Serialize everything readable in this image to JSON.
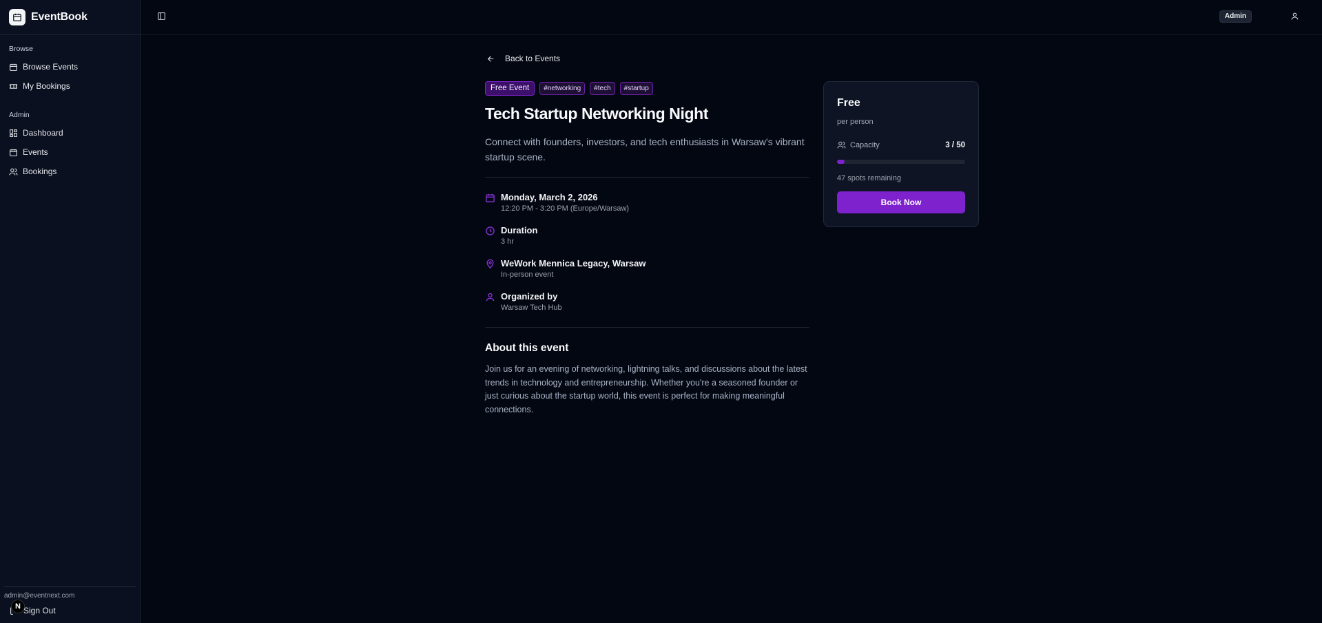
{
  "app": {
    "name": "EventBook"
  },
  "sidebar": {
    "groups": [
      {
        "label": "Browse",
        "items": [
          {
            "label": "Browse Events",
            "icon": "calendar-icon"
          },
          {
            "label": "My Bookings",
            "icon": "ticket-icon"
          }
        ]
      },
      {
        "label": "Admin",
        "items": [
          {
            "label": "Dashboard",
            "icon": "dashboard-icon"
          },
          {
            "label": "Events",
            "icon": "calendar-icon"
          },
          {
            "label": "Bookings",
            "icon": "users-icon"
          }
        ]
      }
    ],
    "user_email": "admin@eventnext.com",
    "sign_out": "Sign Out"
  },
  "topbar": {
    "role_badge": "Admin"
  },
  "event": {
    "back_label": "Back to Events",
    "badge": "Free Event",
    "tags": [
      "#networking",
      "#tech",
      "#startup"
    ],
    "title": "Tech Startup Networking Night",
    "subtitle": "Connect with founders, investors, and tech enthusiasts in Warsaw's vibrant startup scene.",
    "details": [
      {
        "icon": "calendar-icon",
        "title": "Monday, March 2, 2026",
        "sub": "12:20 PM - 3:20 PM (Europe/Warsaw)"
      },
      {
        "icon": "clock-icon",
        "title": "Duration",
        "sub": "3 hr"
      },
      {
        "icon": "location-pin-icon",
        "title": "WeWork Mennica Legacy, Warsaw",
        "sub": "In-person event"
      },
      {
        "icon": "user-icon",
        "title": "Organized by",
        "sub": "Warsaw Tech Hub"
      }
    ],
    "about_heading": "About this event",
    "about_text": "Join us for an evening of networking, lightning talks, and discussions about the latest trends in technology and entrepreneurship. Whether you're a seasoned founder or just curious about the startup world, this event is perfect for making meaningful connections."
  },
  "booking_card": {
    "price": "Free",
    "per_person": "per person",
    "capacity_label": "Capacity",
    "capacity_value": "3 / 50",
    "capacity_fraction": 0.06,
    "spots_remaining": "47 spots remaining",
    "book_button": "Book Now"
  },
  "colors": {
    "accent": "#7e22ce",
    "background": "#030712",
    "sidebar": "#0b1020"
  }
}
